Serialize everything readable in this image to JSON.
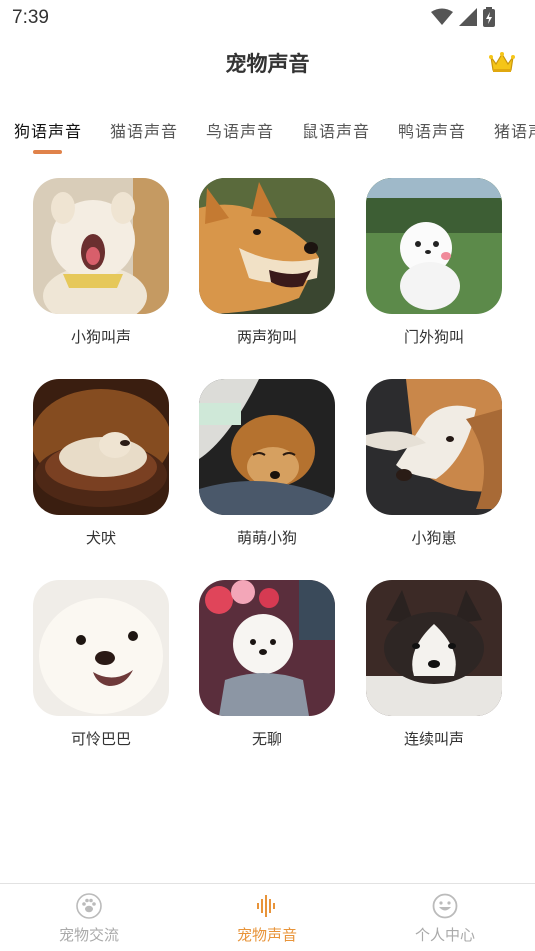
{
  "status": {
    "time": "7:39"
  },
  "header": {
    "title": "宠物声音",
    "vip_icon": "crown-icon"
  },
  "tabs": [
    {
      "label": "狗语声音",
      "active": true
    },
    {
      "label": "猫语声音",
      "active": false
    },
    {
      "label": "鸟语声音",
      "active": false
    },
    {
      "label": "鼠语声音",
      "active": false
    },
    {
      "label": "鸭语声音",
      "active": false
    },
    {
      "label": "猪语声音",
      "active": false
    }
  ],
  "sounds": [
    {
      "label": "小狗叫声"
    },
    {
      "label": "两声狗叫"
    },
    {
      "label": "门外狗叫"
    },
    {
      "label": "犬吠"
    },
    {
      "label": "萌萌小狗"
    },
    {
      "label": "小狗崽"
    },
    {
      "label": "可怜巴巴"
    },
    {
      "label": "无聊"
    },
    {
      "label": "连续叫声"
    }
  ],
  "bottom_nav": [
    {
      "label": "宠物交流",
      "icon": "paw-icon",
      "active": false
    },
    {
      "label": "宠物声音",
      "icon": "sound-wave-icon",
      "active": true
    },
    {
      "label": "个人中心",
      "icon": "smiley-icon",
      "active": false
    }
  ],
  "colors": {
    "accent": "#e8943a",
    "indicator": "#e0824a"
  }
}
